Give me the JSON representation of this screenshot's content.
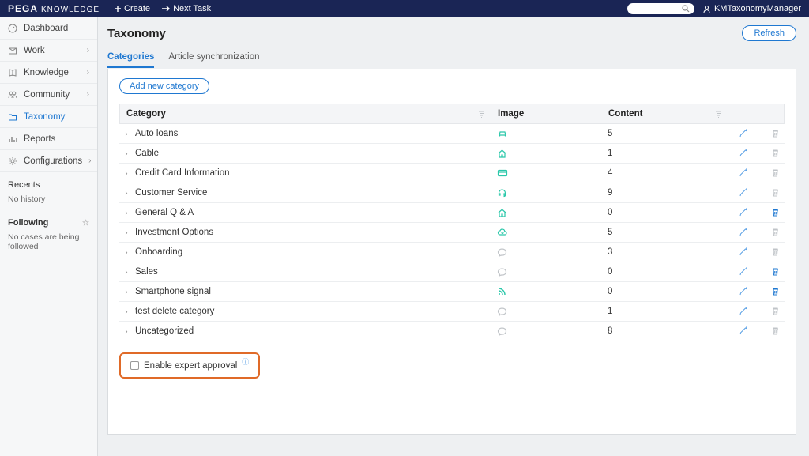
{
  "brand": {
    "name": "PEGA",
    "product": "KNOWLEDGE"
  },
  "header": {
    "create": "Create",
    "next": "Next Task",
    "user": "KMTaxonomyManager"
  },
  "sidebar": {
    "items": [
      {
        "label": "Dashboard",
        "icon": "gauge",
        "expand": false,
        "active": false
      },
      {
        "label": "Work",
        "icon": "inbox",
        "expand": true,
        "active": false
      },
      {
        "label": "Knowledge",
        "icon": "book",
        "expand": true,
        "active": false
      },
      {
        "label": "Community",
        "icon": "users",
        "expand": true,
        "active": false
      },
      {
        "label": "Taxonomy",
        "icon": "folder",
        "expand": false,
        "active": true
      },
      {
        "label": "Reports",
        "icon": "bars",
        "expand": false,
        "active": false
      },
      {
        "label": "Configurations",
        "icon": "gear",
        "expand": true,
        "active": false
      }
    ],
    "recents": {
      "title": "Recents",
      "empty": "No history"
    },
    "following": {
      "title": "Following",
      "empty": "No cases are being followed"
    }
  },
  "page": {
    "title": "Taxonomy",
    "refresh": "Refresh",
    "tabs": [
      {
        "label": "Categories",
        "active": true
      },
      {
        "label": "Article synchronization",
        "active": false
      }
    ],
    "addCategory": "Add new category",
    "columns": {
      "category": "Category",
      "image": "Image",
      "content": "Content"
    },
    "expertApproval": "Enable expert approval"
  },
  "categories": [
    {
      "name": "Auto loans",
      "icon": "car",
      "muted": false,
      "content": "5",
      "delete": false
    },
    {
      "name": "Cable",
      "icon": "home",
      "muted": false,
      "content": "1",
      "delete": false
    },
    {
      "name": "Credit Card Information",
      "icon": "card",
      "muted": false,
      "content": "4",
      "delete": false
    },
    {
      "name": "Customer Service",
      "icon": "headset",
      "muted": false,
      "content": "9",
      "delete": false
    },
    {
      "name": "General Q & A",
      "icon": "home",
      "muted": false,
      "content": "0",
      "delete": true
    },
    {
      "name": "Investment Options",
      "icon": "cloud",
      "muted": false,
      "content": "5",
      "delete": false
    },
    {
      "name": "Onboarding",
      "icon": "bubble",
      "muted": true,
      "content": "3",
      "delete": false
    },
    {
      "name": "Sales",
      "icon": "bubble",
      "muted": true,
      "content": "0",
      "delete": true
    },
    {
      "name": "Smartphone signal",
      "icon": "rss",
      "muted": false,
      "content": "0",
      "delete": true
    },
    {
      "name": "test delete category",
      "icon": "bubble",
      "muted": true,
      "content": "1",
      "delete": false
    },
    {
      "name": "Uncategorized",
      "icon": "bubble",
      "muted": true,
      "content": "8",
      "delete": false
    }
  ]
}
